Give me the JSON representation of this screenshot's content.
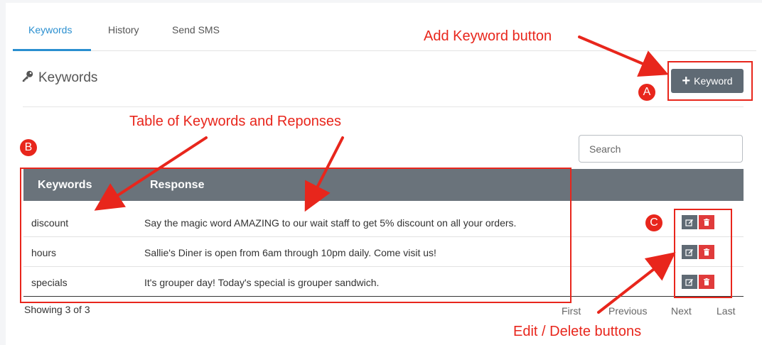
{
  "tabs": [
    {
      "label": "Keywords",
      "active": true
    },
    {
      "label": "History",
      "active": false
    },
    {
      "label": "Send SMS",
      "active": false
    }
  ],
  "header": {
    "title": "Keywords",
    "title_icon": "key-icon",
    "add_button_label": "Keyword",
    "add_button_icon": "plus-icon"
  },
  "search": {
    "placeholder": "Search"
  },
  "table": {
    "columns": [
      "Keywords",
      "Response"
    ],
    "rows": [
      {
        "keyword": "discount",
        "response": "Say the magic word AMAZING to our wait staff to get 5% discount on all your orders."
      },
      {
        "keyword": "hours",
        "response": "Sallie's Diner is open from 6am through 10pm daily. Come visit us!"
      },
      {
        "keyword": "specials",
        "response": "It's grouper day! Today's special is grouper sandwich."
      }
    ],
    "row_actions": [
      "edit-icon",
      "trash-icon"
    ]
  },
  "footer": {
    "showing": "Showing 3 of 3",
    "pager": [
      "First",
      "Previous",
      "Next",
      "Last"
    ]
  },
  "annotations": {
    "add_keyword": "Add Keyword button",
    "table": "Table of Keywords and Reponses",
    "edit_delete": "Edit / Delete buttons",
    "badges": [
      "A",
      "B",
      "C"
    ]
  },
  "colors": {
    "accent": "#2a8fd0",
    "button": "#5f6a74",
    "table_header": "#6a737b",
    "delete": "#e03b3b",
    "annotation": "#e8261c"
  }
}
